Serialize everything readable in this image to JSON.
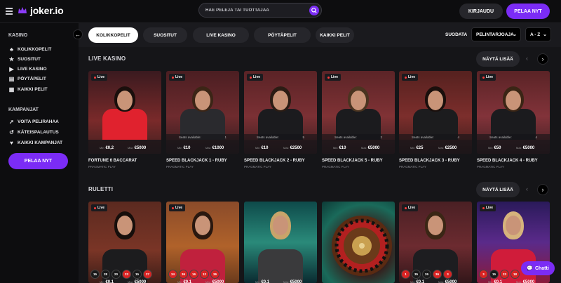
{
  "header": {
    "logo_text": "joker.io",
    "search_placeholder": "HAE PELEJÄ TAI TUOTTAJAA",
    "login_label": "KIRJAUDU",
    "play_label": "PELAA NYT"
  },
  "sidebar": {
    "casino_heading": "KASINO",
    "casino_items": [
      {
        "label": "KOLIKKOPELIT",
        "icon": "slot-icon"
      },
      {
        "label": "SUOSITUT",
        "icon": "star-icon"
      },
      {
        "label": "LIVE KASINO",
        "icon": "live-icon"
      },
      {
        "label": "PÖYTÄPELIT",
        "icon": "cards-icon"
      },
      {
        "label": "KAIKKI PELIT",
        "icon": "grid-icon"
      }
    ],
    "campaigns_heading": "KAMPANJAT",
    "campaign_items": [
      {
        "label": "VOITA PELIRAHAA",
        "icon": "rocket-icon"
      },
      {
        "label": "KÄTEISPALAUTUS",
        "icon": "cashback-icon"
      },
      {
        "label": "KAIKKI KAMPANJAT",
        "icon": "heart-icon"
      }
    ],
    "cta_label": "PELAA NYT"
  },
  "tabs": [
    "KOLIKKOPELIT",
    "SUOSITUT",
    "LIVE KASINO",
    "PÖYTÄPELIT",
    "KAIKKI PELIT"
  ],
  "filters": {
    "sort_label": "SUODATA",
    "provider_select": "PELINTARJOAJA",
    "order_select": "A - Z"
  },
  "sections": {
    "live": {
      "title": "LIVE KASINO",
      "more_label": "NÄYTÄ LISÄÄ",
      "games": [
        {
          "name": "FORTUNE 6 BACCARAT",
          "provider": "PRAGMATIC PLAY",
          "live": "Live",
          "min": "€0,2",
          "max": "€5000",
          "seats": "",
          "seat_count": ""
        },
        {
          "name": "SPEED BLACKJACK 1 - RUBY",
          "provider": "PRAGMATIC PLAY",
          "live": "Live",
          "min": "€10",
          "max": "€1000",
          "seats": "Seats available:",
          "seat_count": "1"
        },
        {
          "name": "SPEED BLACKJACK 2 - RUBY",
          "provider": "PRAGMATIC PLAY",
          "live": "Live",
          "min": "€10",
          "max": "€2500",
          "seats": "Seats available:",
          "seat_count": "5"
        },
        {
          "name": "SPEED BLACKJACK 5 - RUBY",
          "provider": "PRAGMATIC PLAY",
          "live": "Live",
          "min": "€10",
          "max": "€5000",
          "seats": "Seats available:",
          "seat_count": "2"
        },
        {
          "name": "SPEED BLACKJACK 3 - RUBY",
          "provider": "PRAGMATIC PLAY",
          "live": "Live",
          "min": "€25",
          "max": "€2500",
          "seats": "Seats available:",
          "seat_count": "4"
        },
        {
          "name": "SPEED BLACKJACK 4 - RUBY",
          "provider": "PRAGMATIC PLAY",
          "live": "Live",
          "min": "€50",
          "max": "€5000",
          "seats": "Seats available:",
          "seat_count": "4"
        }
      ]
    },
    "roulette": {
      "title": "RULETTI",
      "more_label": "NÄYTÄ LISÄÄ",
      "games": [
        {
          "live": "Live",
          "numbers": [
            "15",
            "28",
            "20",
            "23",
            "15",
            "27"
          ],
          "min": "€0,1",
          "max": "€5000"
        },
        {
          "live": "Live",
          "numbers": [
            "34",
            "36",
            "16",
            "12",
            "36"
          ],
          "min": "€0,1",
          "max": "€5000"
        },
        {
          "live": "",
          "numbers": [],
          "min": "€0,1",
          "max": "€5000"
        },
        {
          "live": "",
          "numbers": [],
          "min": "",
          "max": ""
        },
        {
          "live": "Live",
          "numbers": [
            "1",
            "35",
            "26",
            "36",
            "3"
          ],
          "min": "€0,1",
          "max": "€5000"
        },
        {
          "live": "Live",
          "numbers": [
            "3",
            "15",
            "23",
            "18"
          ],
          "min": "€0,1",
          "max": "€5000"
        }
      ]
    }
  },
  "chat_label": "Chatti",
  "colors": {
    "accent": "#7b2cf5",
    "background": "#151518"
  }
}
